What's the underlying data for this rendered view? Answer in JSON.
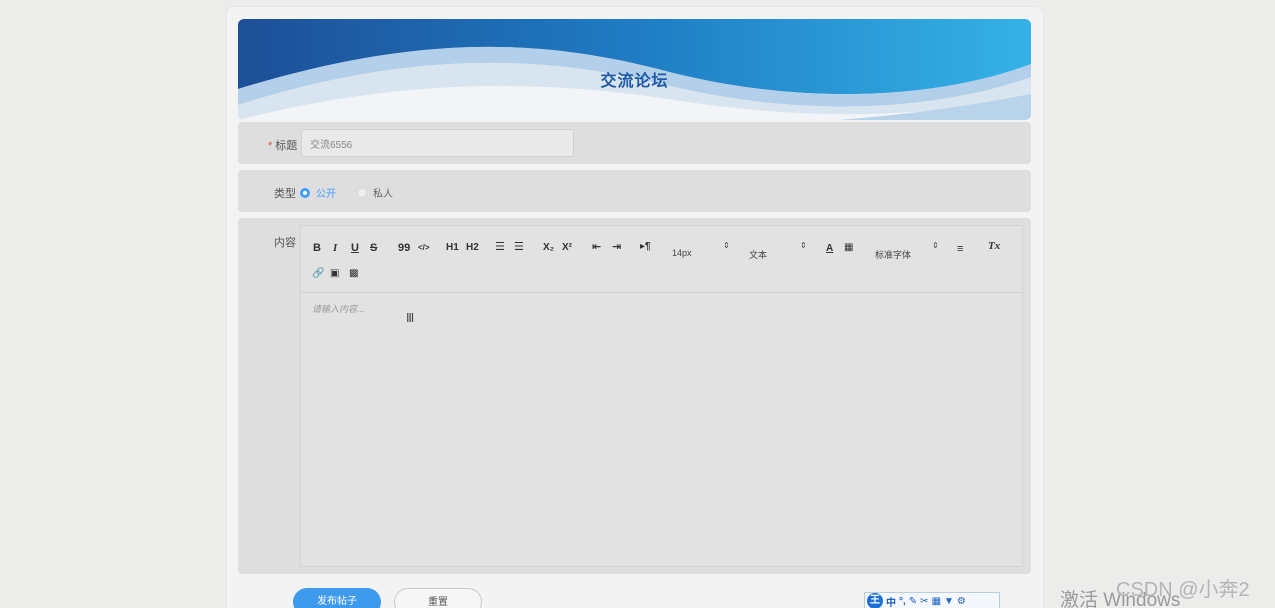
{
  "page": {
    "title": "交流论坛"
  },
  "form": {
    "title_label": "标题",
    "required_mark": "*",
    "title_value": "交流6556",
    "type_label": "类型",
    "type_options": [
      "公开",
      "私人"
    ],
    "type_selected": "公开",
    "content_label": "内容"
  },
  "editor": {
    "toolbar": {
      "bold": "B",
      "italic": "I",
      "underline": "U",
      "strike": "S",
      "quote": "99",
      "code": "</>",
      "h1": "H1",
      "h2": "H2",
      "sub": "X₂",
      "sup": "X²",
      "size_value": "14px",
      "header_value": "文本",
      "font_value": "标准字体",
      "color_a": "A",
      "clean": "Tx"
    },
    "placeholder": "请输入内容..."
  },
  "actions": {
    "submit": "发布帖子",
    "reset": "重置"
  },
  "ime": {
    "badge": "王",
    "mode": "中",
    "icons": [
      "°,",
      "✎",
      "✂",
      "▦",
      "▼",
      "⚙"
    ]
  },
  "overlay": {
    "activate_windows": "激活 Windows",
    "watermark": "CSDN @小奔2"
  },
  "colors": {
    "accent": "#409eff",
    "title": "#1d5aa7",
    "primary_button": "#3e9aed"
  }
}
